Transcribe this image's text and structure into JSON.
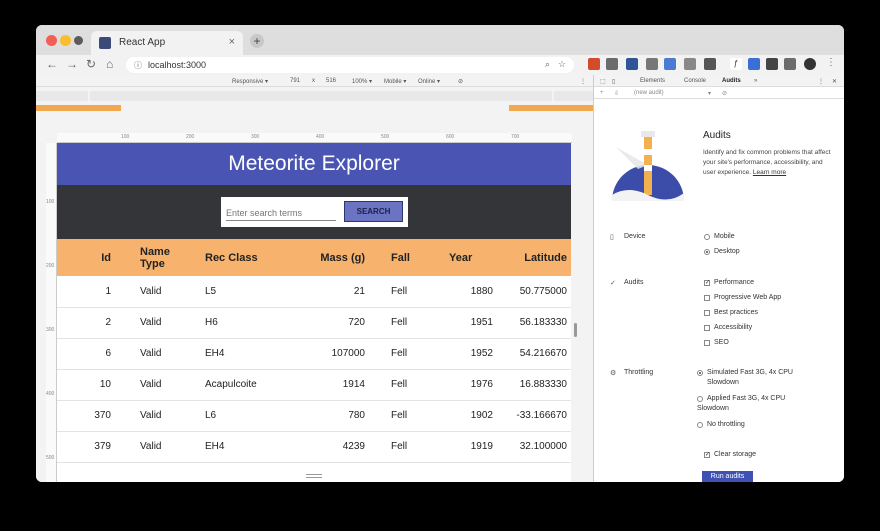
{
  "browser": {
    "tab_title": "React App",
    "tab_close": "×",
    "new_tab": "+",
    "url": "localhost:3000"
  },
  "device_toolbar": {
    "mode": "Responsive ▾",
    "width": "791",
    "times": "x",
    "height": "516",
    "zoom": "100% ▾",
    "device": "Mobile ▾",
    "network": "Online ▾"
  },
  "rulers": {
    "top": [
      "100",
      "200",
      "300",
      "400",
      "500",
      "600",
      "700"
    ],
    "left": [
      "100",
      "200",
      "300",
      "400",
      "500"
    ]
  },
  "app": {
    "title": "Meteorite Explorer",
    "search_placeholder": "Enter search terms",
    "search_button": "SEARCH",
    "columns": [
      "Id",
      "Name Type",
      "Rec Class",
      "Mass (g)",
      "Fall",
      "Year",
      "Latitude"
    ],
    "rows": [
      {
        "id": "1",
        "name_type": "Valid",
        "rec_class": "L5",
        "mass": "21",
        "fall": "Fell",
        "year": "1880",
        "latitude": "50.775000"
      },
      {
        "id": "2",
        "name_type": "Valid",
        "rec_class": "H6",
        "mass": "720",
        "fall": "Fell",
        "year": "1951",
        "latitude": "56.183330"
      },
      {
        "id": "6",
        "name_type": "Valid",
        "rec_class": "EH4",
        "mass": "107000",
        "fall": "Fell",
        "year": "1952",
        "latitude": "54.216670"
      },
      {
        "id": "10",
        "name_type": "Valid",
        "rec_class": "Acapulcoite",
        "mass": "1914",
        "fall": "Fell",
        "year": "1976",
        "latitude": "16.883330"
      },
      {
        "id": "370",
        "name_type": "Valid",
        "rec_class": "L6",
        "mass": "780",
        "fall": "Fell",
        "year": "1902",
        "latitude": "-33.166670"
      },
      {
        "id": "379",
        "name_type": "Valid",
        "rec_class": "EH4",
        "mass": "4239",
        "fall": "Fell",
        "year": "1919",
        "latitude": "32.100000"
      }
    ]
  },
  "devtools": {
    "tabs": [
      "Elements",
      "Console",
      "Audits",
      "»"
    ],
    "active_tab": "Audits",
    "audit_select": "(new audit)",
    "title": "Audits",
    "description": "Identify and fix common problems that affect your site's performance, accessibility, and user experience.",
    "learn_more": "Learn more",
    "device_label": "Device",
    "device_options": [
      "Mobile",
      "Desktop"
    ],
    "audits_label": "Audits",
    "audit_options": [
      "Performance",
      "Progressive Web App",
      "Best practices",
      "Accessibility",
      "SEO"
    ],
    "throttling_label": "Throttling",
    "throttling_options": [
      "Simulated Fast 3G, 4x CPU Slowdown",
      "Applied Fast 3G, 4x CPU Slowdown",
      "No throttling"
    ],
    "clear_storage": "Clear storage",
    "run_button": "Run audits",
    "accent_color": "#3f51b5"
  }
}
